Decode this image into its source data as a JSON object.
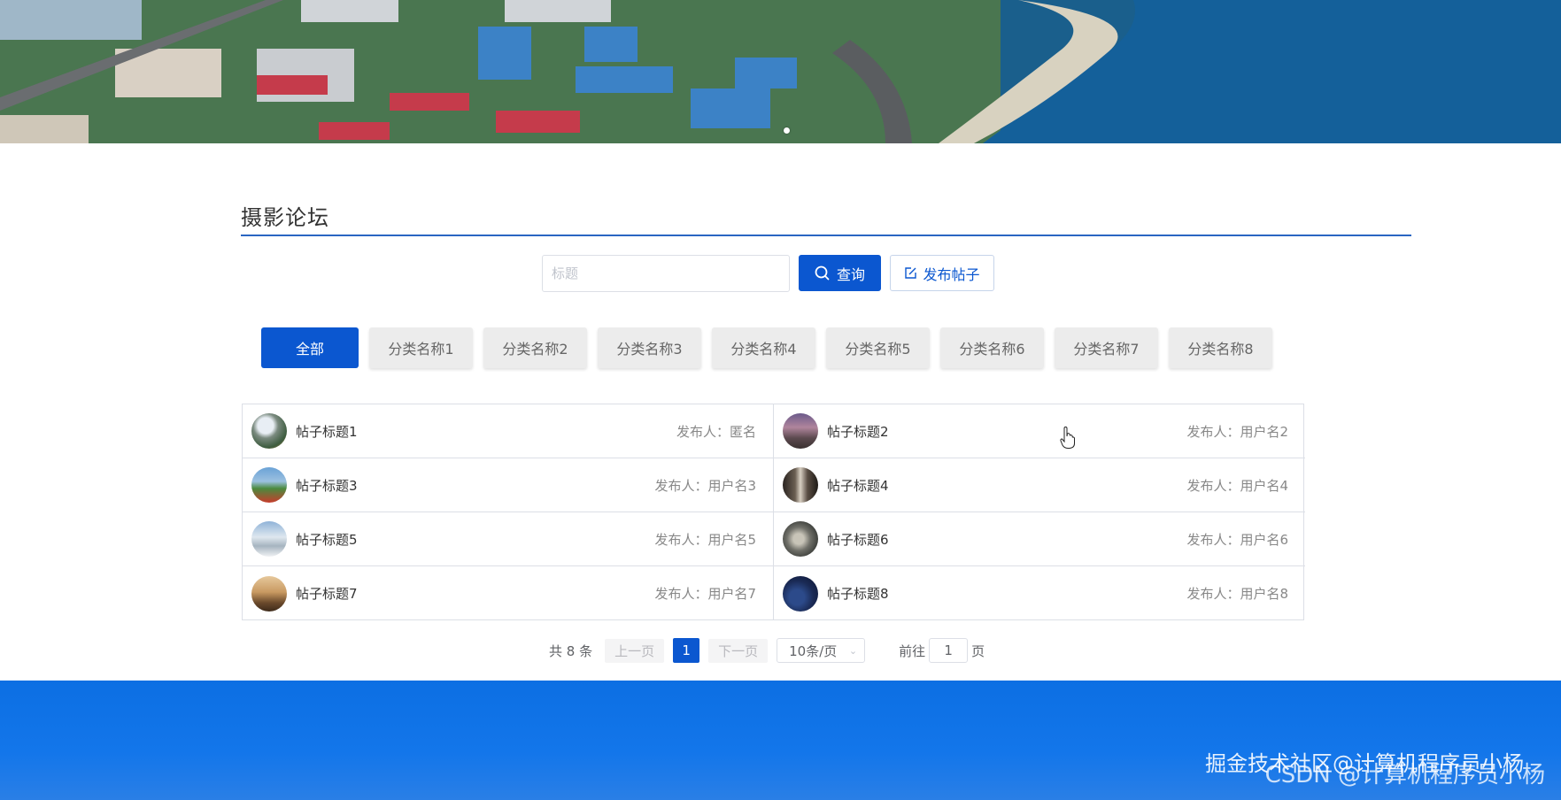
{
  "forum": {
    "title": "摄影论坛",
    "search_placeholder": "标题",
    "query_label": "查询",
    "publish_label": "发布帖子"
  },
  "categories": [
    "全部",
    "分类名称1",
    "分类名称2",
    "分类名称3",
    "分类名称4",
    "分类名称5",
    "分类名称6",
    "分类名称7",
    "分类名称8"
  ],
  "posts": [
    {
      "title": "帖子标题1",
      "author": "发布人：匿名"
    },
    {
      "title": "帖子标题2",
      "author": "发布人：用户名2"
    },
    {
      "title": "帖子标题3",
      "author": "发布人：用户名3"
    },
    {
      "title": "帖子标题4",
      "author": "发布人：用户名4"
    },
    {
      "title": "帖子标题5",
      "author": "发布人：用户名5"
    },
    {
      "title": "帖子标题6",
      "author": "发布人：用户名6"
    },
    {
      "title": "帖子标题7",
      "author": "发布人：用户名7"
    },
    {
      "title": "帖子标题8",
      "author": "发布人：用户名8"
    }
  ],
  "pagination": {
    "total": "共 8 条",
    "prev": "上一页",
    "current": "1",
    "next": "下一页",
    "page_size": "10条/页",
    "goto": "前往",
    "goto_value": "1",
    "page_suffix": "页"
  },
  "footer": {
    "watermark": "掘金技术社区@计算机程序员小杨",
    "watermark2": "CSDN @计算机程序员小杨"
  },
  "colors": {
    "primary": "#0b57d0",
    "footer": "#0c6fe3"
  }
}
